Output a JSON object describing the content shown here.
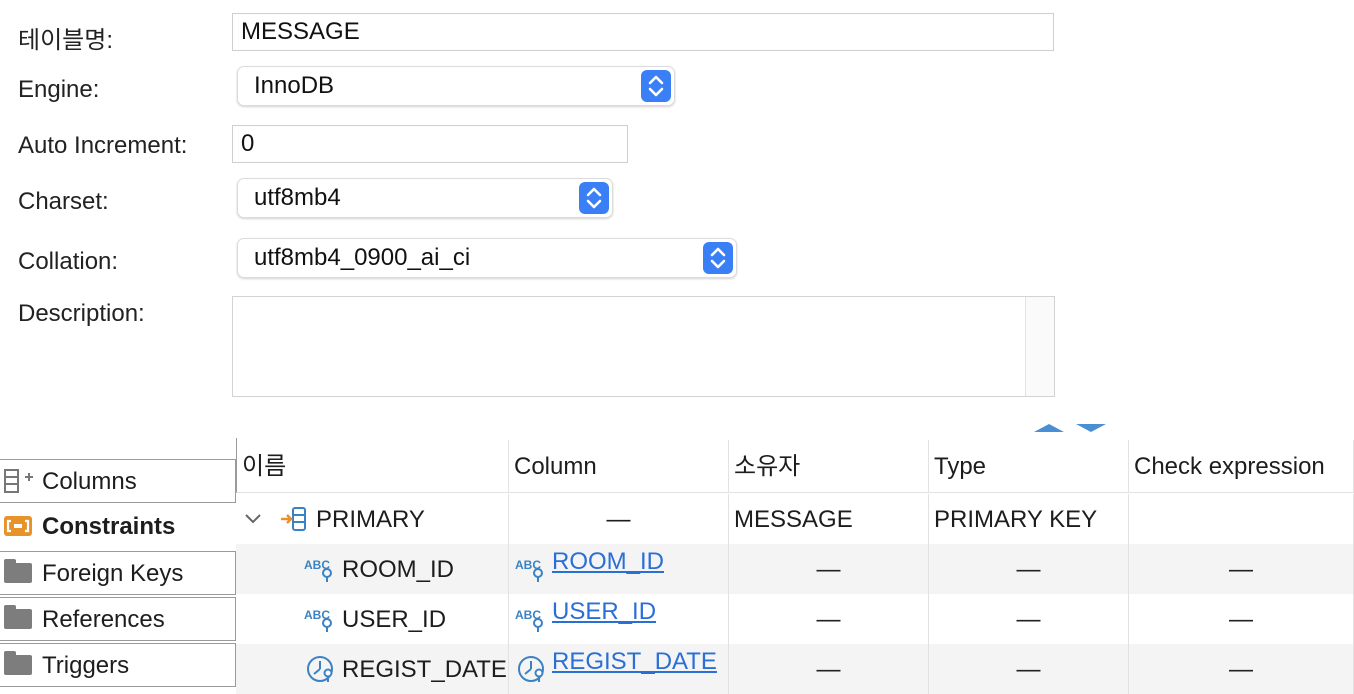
{
  "form": {
    "table_name_label": "테이블명:",
    "table_name_value": "MESSAGE",
    "engine_label": "Engine:",
    "engine_value": "InnoDB",
    "auto_increment_label": "Auto Increment:",
    "auto_increment_value": "0",
    "charset_label": "Charset:",
    "charset_value": "utf8mb4",
    "collation_label": "Collation:",
    "collation_value": "utf8mb4_0900_ai_ci",
    "description_label": "Description:",
    "description_value": ""
  },
  "tabs": [
    {
      "label": "Columns",
      "icon": "columns-icon",
      "active": false
    },
    {
      "label": "Constraints",
      "icon": "constraints-icon",
      "active": true
    },
    {
      "label": "Foreign Keys",
      "icon": "folder-icon",
      "active": false
    },
    {
      "label": "References",
      "icon": "folder-icon",
      "active": false
    },
    {
      "label": "Triggers",
      "icon": "folder-icon",
      "active": false
    }
  ],
  "grid": {
    "headers": [
      "이름",
      "Column",
      "소유자",
      "Type",
      "Check expression"
    ],
    "rows": [
      {
        "name": "PRIMARY",
        "column": "—",
        "owner": "MESSAGE",
        "type": "PRIMARY KEY",
        "check": ""
      },
      {
        "name": "ROOM_ID",
        "column": "ROOM_ID",
        "owner": "—",
        "type": "—",
        "check": "—"
      },
      {
        "name": "USER_ID",
        "column": "USER_ID",
        "owner": "—",
        "type": "—",
        "check": "—"
      },
      {
        "name": "REGIST_DATE",
        "column": "REGIST_DATE",
        "owner": "—",
        "type": "—",
        "check": "—"
      }
    ]
  },
  "colors": {
    "accent": "#3a7ff6",
    "link": "#2a6fd6",
    "icon_blue": "#3b82c4",
    "icon_orange": "#e8922a"
  }
}
